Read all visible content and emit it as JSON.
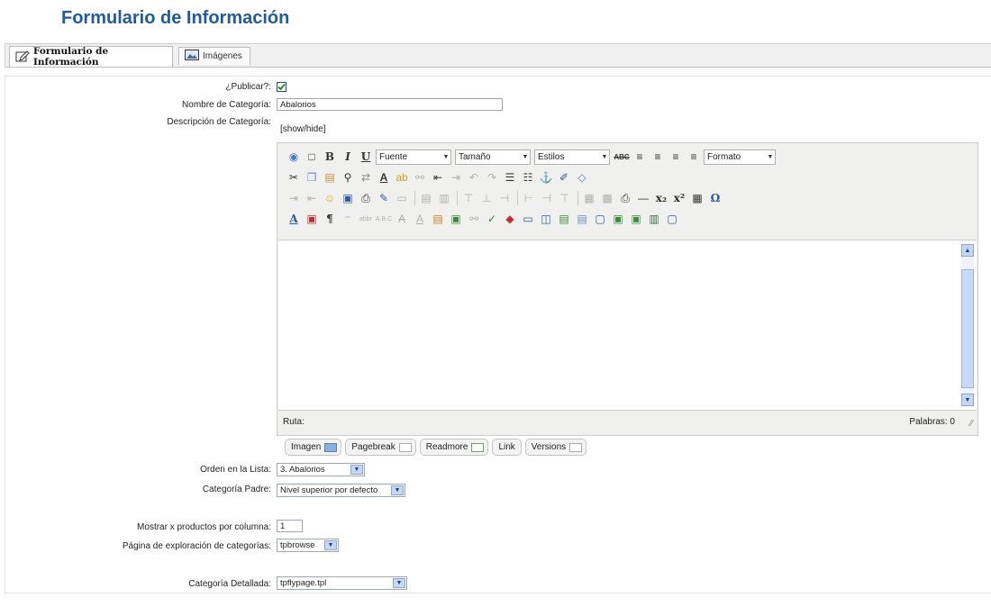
{
  "page": {
    "title": "Formulario de Información"
  },
  "tabs": [
    {
      "label": "Formulario de Información",
      "icon": "edit-form-icon"
    },
    {
      "label": "Imágenes",
      "icon": "image-icon"
    }
  ],
  "form": {
    "publish": {
      "label": "¿Publicar?:",
      "checked": true
    },
    "category_name": {
      "label": "Nombre de Categoría:",
      "value": "Abalorios"
    },
    "category_description": {
      "label": "Descripción de Categoría:",
      "toggle": "[show/hide]"
    },
    "list_order": {
      "label": "Orden en la Lista:",
      "value": "3. Abalorios"
    },
    "parent_category": {
      "label": "Categoría Padre:",
      "value": "Nivel superior por defecto"
    },
    "products_per_row": {
      "label": "Mostrar x productos por columna:",
      "value": "1"
    },
    "browse_page": {
      "label": "Página de exploración de categorías:",
      "value": "tpbrowse"
    },
    "detail_category": {
      "label": "Categoría Detallada:",
      "value": "tpflypage.tpl"
    }
  },
  "editor": {
    "font_select": "Fuente",
    "size_select": "Tamaño",
    "styles_select": "Estilos",
    "format_select": "Formato",
    "path_label": "Ruta:",
    "word_count": "Palabras: 0"
  },
  "editor_buttons": [
    {
      "label": "Imagen",
      "icon": "image-insert-icon"
    },
    {
      "label": "Pagebreak",
      "icon": "pagebreak-icon"
    },
    {
      "label": "Readmore",
      "icon": "readmore-icon"
    },
    {
      "label": "Link",
      "icon": ""
    },
    {
      "label": "Versions",
      "icon": "versions-icon"
    }
  ],
  "colors": {
    "title": "#1f5c99",
    "accent": "#c6d7f5",
    "border": "#cccccc"
  }
}
